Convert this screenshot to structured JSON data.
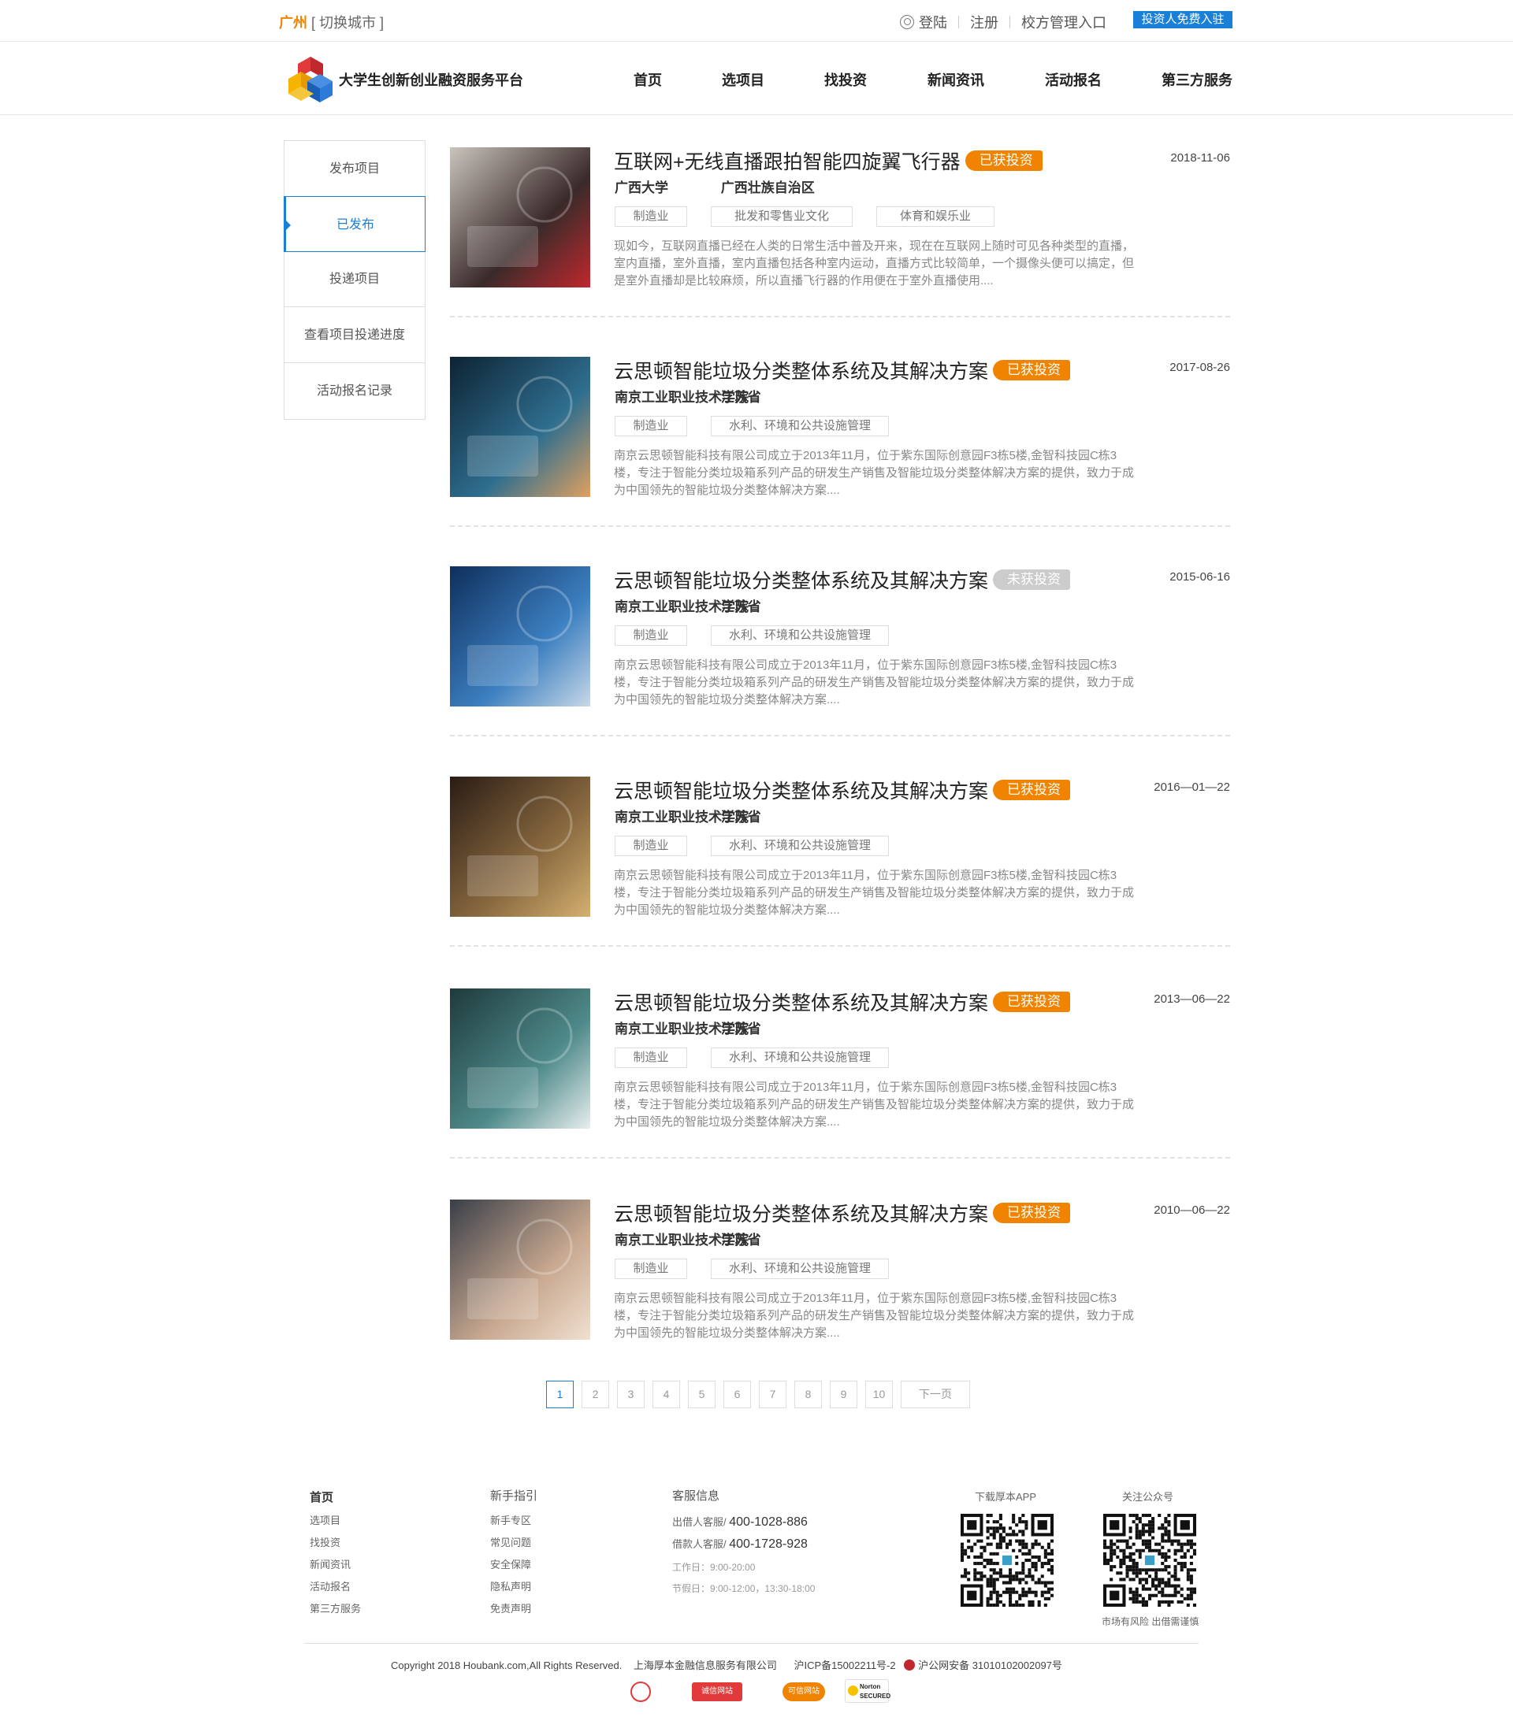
{
  "topbar": {
    "city": "广州",
    "switch_city": "[ 切换城市 ]",
    "login": "登陆",
    "register": "注册",
    "school_admin": "校方管理入口",
    "investor_entry": "投资人免费入驻"
  },
  "header": {
    "site_name": "大学生创新创业融资服务平台",
    "nav": [
      "首页",
      "选项目",
      "找投资",
      "新闻资讯",
      "活动报名",
      "第三方服务"
    ]
  },
  "sidebar": {
    "items": [
      "发布项目",
      "已发布",
      "投递项目",
      "查看项目投递进度",
      "活动报名记录"
    ],
    "active": "已发布"
  },
  "projects": [
    {
      "title": "互联网+无线直播跟拍智能四旋翼飞行器",
      "status": "已获投资",
      "date": "2018-11-06",
      "school": "广西大学",
      "region": "广西壮族自治区",
      "tags": [
        "制造业",
        "批发和零售业文化",
        "体育和娱乐业"
      ],
      "desc": "现如今，互联网直播已经在人类的日常生活中普及开来，现在在互联网上随时可见各种类型的直播，室内直播，室外直播，室内直播包括各种室内运动，直播方式比较简单，一个摄像头便可以搞定，但是室外直播却是比较麻烦，所以直播飞行器的作用便在于室外直播使用....",
      "thumb_colors": [
        "#c9c4bd",
        "#3a2a2a",
        "#c0282d"
      ]
    },
    {
      "title": "云思顿智能垃圾分类整体系统及其解决方案",
      "status": "已获投资",
      "date": "2017-08-26",
      "school": "南京工业职业技术学院",
      "region": "江苏省",
      "tags": [
        "制造业",
        "水利、环境和公共设施管理"
      ],
      "desc": "南京云思顿智能科技有限公司成立于2013年11月，位于紫东国际创意园F3栋5楼,金智科技园C栋3楼，专注于智能分类垃圾箱系列产品的研发生产销售及智能垃圾分类整体解决方案的提供，致力于成为中国领先的智能垃圾分类整体解决方案....",
      "thumb_colors": [
        "#0d2333",
        "#2f6e8f",
        "#e0a060"
      ]
    },
    {
      "title": "云思顿智能垃圾分类整体系统及其解决方案",
      "status": "未获投资",
      "date": "2015-06-16",
      "school": "南京工业职业技术学院",
      "region": "江苏省",
      "tags": [
        "制造业",
        "水利、环境和公共设施管理"
      ],
      "desc": "南京云思顿智能科技有限公司成立于2013年11月，位于紫东国际创意园F3栋5楼,金智科技园C栋3楼，专注于智能分类垃圾箱系列产品的研发生产销售及智能垃圾分类整体解决方案的提供，致力于成为中国领先的智能垃圾分类整体解决方案....",
      "thumb_colors": [
        "#0e2f5c",
        "#3c7fc0",
        "#c8d8e8"
      ]
    },
    {
      "title": "云思顿智能垃圾分类整体系统及其解决方案",
      "status": "已获投资",
      "date": "2016—01—22",
      "school": "南京工业职业技术学院",
      "region": "江苏省",
      "tags": [
        "制造业",
        "水利、环境和公共设施管理"
      ],
      "desc": "南京云思顿智能科技有限公司成立于2013年11月，位于紫东国际创意园F3栋5楼,金智科技园C栋3楼，专注于智能分类垃圾箱系列产品的研发生产销售及智能垃圾分类整体解决方案的提供，致力于成为中国领先的智能垃圾分类整体解决方案....",
      "thumb_colors": [
        "#2a1c14",
        "#8a6a40",
        "#d4b070"
      ]
    },
    {
      "title": "云思顿智能垃圾分类整体系统及其解决方案",
      "status": "已获投资",
      "date": "2013—06—22",
      "school": "南京工业职业技术学院",
      "region": "江苏省",
      "tags": [
        "制造业",
        "水利、环境和公共设施管理"
      ],
      "desc": "南京云思顿智能科技有限公司成立于2013年11月，位于紫东国际创意园F3栋5楼,金智科技园C栋3楼，专注于智能分类垃圾箱系列产品的研发生产销售及智能垃圾分类整体解决方案的提供，致力于成为中国领先的智能垃圾分类整体解决方案....",
      "thumb_colors": [
        "#1e3a3c",
        "#4f8a8a",
        "#e8eeee"
      ]
    },
    {
      "title": "云思顿智能垃圾分类整体系统及其解决方案",
      "status": "已获投资",
      "date": "2010—06—22",
      "school": "南京工业职业技术学院",
      "region": "江苏省",
      "tags": [
        "制造业",
        "水利、环境和公共设施管理"
      ],
      "desc": "南京云思顿智能科技有限公司成立于2013年11月，位于紫东国际创意园F3栋5楼,金智科技园C栋3楼，专注于智能分类垃圾箱系列产品的研发生产销售及智能垃圾分类整体解决方案的提供，致力于成为中国领先的智能垃圾分类整体解决方案....",
      "thumb_colors": [
        "#3a3f48",
        "#c8a890",
        "#f0e0d0"
      ]
    }
  ],
  "pagination": {
    "pages": [
      "1",
      "2",
      "3",
      "4",
      "5",
      "6",
      "7",
      "8",
      "9",
      "10"
    ],
    "current": "1",
    "next": "下一页"
  },
  "footer": {
    "col1": {
      "title": "首页",
      "links": [
        "选项目",
        "找投资",
        "新闻资讯",
        "活动报名",
        "第三方服务"
      ]
    },
    "col2": {
      "title": "新手指引",
      "links": [
        "新手专区",
        "常见问题",
        "安全保障",
        "隐私声明",
        "免责声明"
      ]
    },
    "service": {
      "title": "客服信息",
      "line1_label": "出借人客服/",
      "line1_phone": "400-1028-886",
      "line2_label": "借款人客服/",
      "line2_phone": "400-1728-928",
      "workday": "工作日：9:00-20:00",
      "holiday": "节假日：9:00-12:00，13:30-18:00"
    },
    "app_title": "下载厚本APP",
    "wechat_title": "关注公众号",
    "risk_note": "市场有风险 出借需谨慎",
    "copyright": "Copyright 2018 Houbank.com,All Rights Reserved.",
    "company": "上海厚本金融信息服务有限公司",
    "icp": "沪ICP备15002211号-2",
    "police": "沪公网安备 31010102002097号",
    "badges": [
      "诚信网站",
      "可信网站",
      "Norton SECURED"
    ]
  },
  "colors": {
    "accent": "#1a7fd6",
    "orange": "#f08300",
    "badge_grey": "#cccccc"
  }
}
